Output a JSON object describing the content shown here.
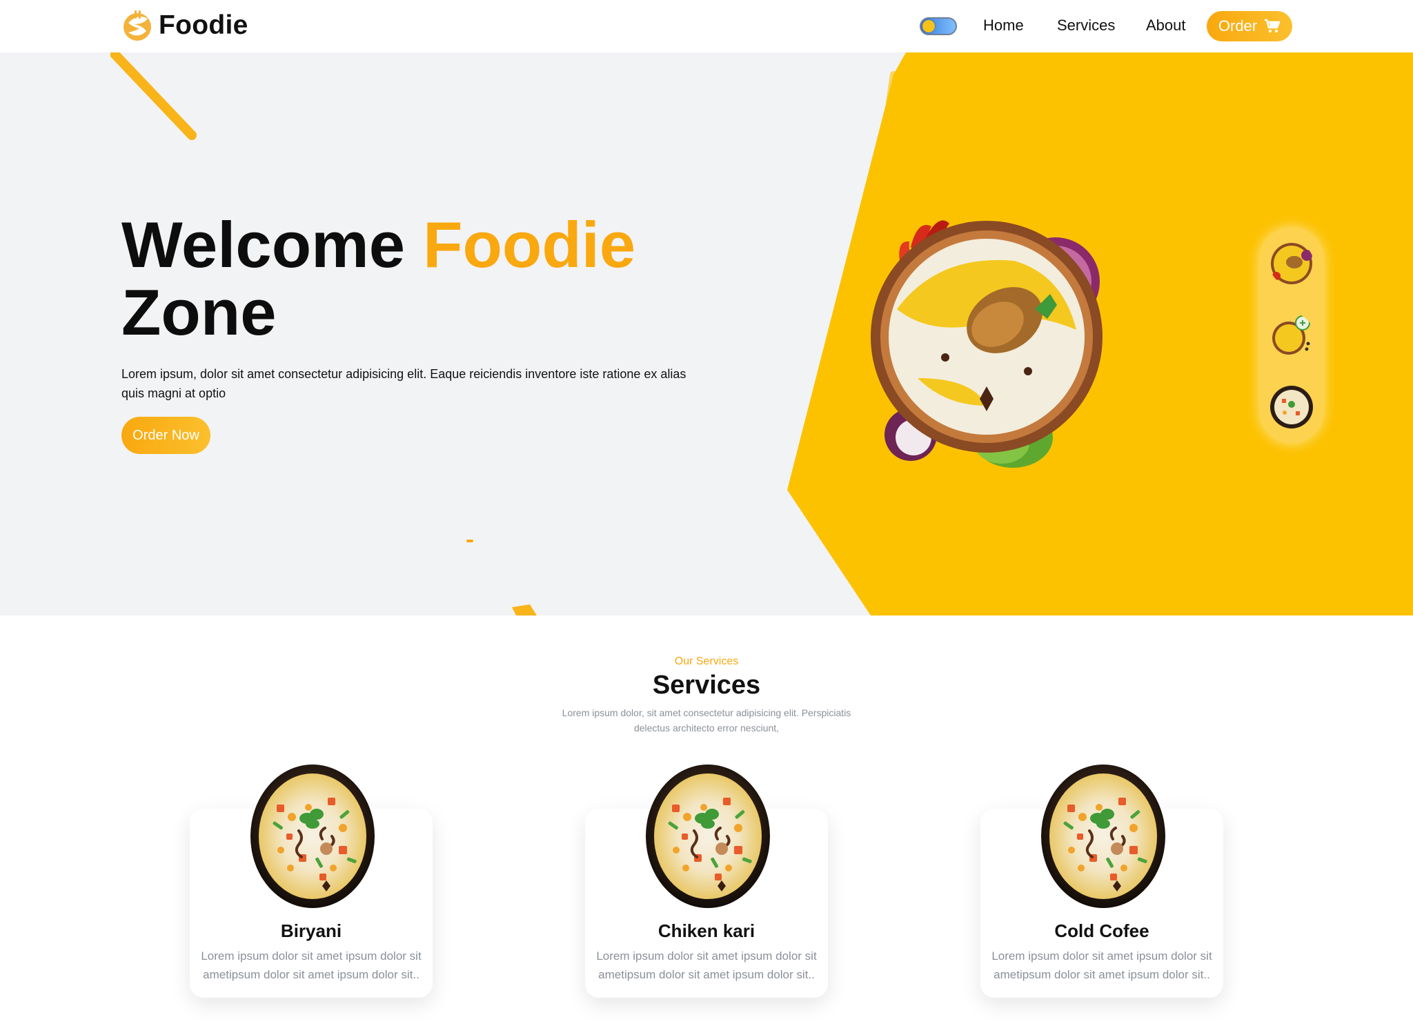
{
  "brand": {
    "name": "Foodie",
    "accent_color": "#f9a80f"
  },
  "nav": {
    "theme_toggle_icon": "theme-toggle-icon",
    "links": [
      "Home",
      "Services",
      "About"
    ],
    "order_label": "Order",
    "order_icon": "cart-icon"
  },
  "hero": {
    "title_start": "Welcome ",
    "title_accent": "Foodie",
    "title_end": "Zone",
    "description": "Lorem ipsum, dolor sit amet consectetur adipisicing elit. Eaque reiciendis inventore iste ratione ex alias quis magni at optio",
    "cta_label": "Order Now",
    "yellow_color": "#fcc200",
    "thumbnails": [
      "chicken-biryani",
      "rice-plate",
      "veg-biryani"
    ]
  },
  "services": {
    "eyebrow": "Our Services",
    "title": "Services",
    "description": "Lorem ipsum dolor, sit amet consectetur adipisicing elit. Perspiciatis delectus architecto error nesciunt,",
    "cards": [
      {
        "name": "Biryani",
        "text": "Lorem ipsum dolor sit amet ipsum dolor sit ametipsum dolor sit amet ipsum dolor sit.."
      },
      {
        "name": "Chiken kari",
        "text": "Lorem ipsum dolor sit amet ipsum dolor sit ametipsum dolor sit amet ipsum dolor sit.."
      },
      {
        "name": "Cold Cofee",
        "text": "Lorem ipsum dolor sit amet ipsum dolor sit ametipsum dolor sit amet ipsum dolor sit.."
      }
    ]
  }
}
